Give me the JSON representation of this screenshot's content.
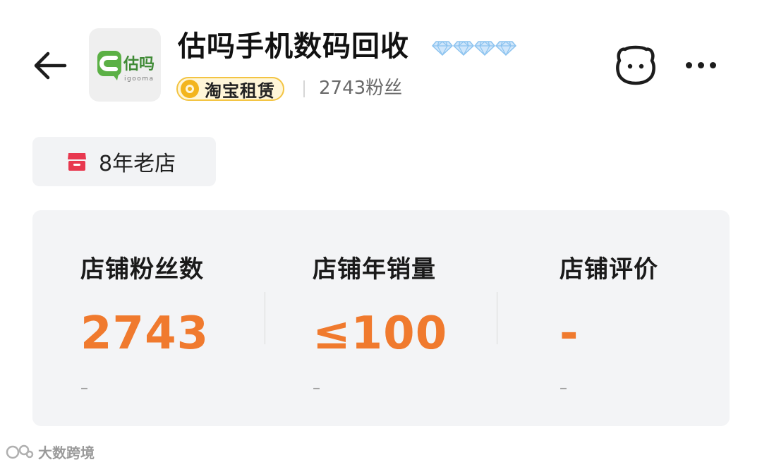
{
  "header": {
    "shop_name": "估吗手机数码回收",
    "logo_text": "估吗",
    "logo_subtext": "igooma",
    "rent_badge": "淘宝租赁",
    "fans": "2743粉丝",
    "diamond_count": 4,
    "icons": {
      "back": "back-arrow-icon",
      "chat": "chat-face-icon",
      "more": "more-dots-icon",
      "diamond": "diamond-icon"
    }
  },
  "age_tag": {
    "label": "8年老店",
    "icon": "store-icon"
  },
  "stats": [
    {
      "label": "店铺粉丝数",
      "value": "2743",
      "sub": "–"
    },
    {
      "label": "店铺年销量",
      "value": "≤100",
      "sub": "–"
    },
    {
      "label": "店铺评价",
      "value": "-",
      "sub": "–"
    }
  ],
  "watermark": {
    "text": "大数跨境"
  },
  "colors": {
    "accent_orange": "#f07a2e",
    "logo_green": "#5bb045",
    "badge_gold": "#f3b51e",
    "store_red": "#e8384f"
  }
}
